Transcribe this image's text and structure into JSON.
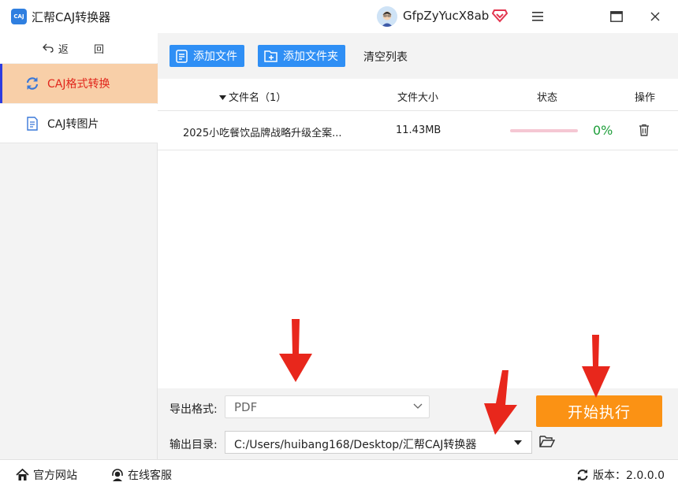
{
  "app": {
    "logo_text": "CAJ",
    "title": "汇帮CAJ转换器",
    "username": "GfpZyYucX8ab"
  },
  "sidebar": {
    "back_label": "返 回",
    "items": [
      {
        "label": "CAJ格式转换",
        "active": true
      },
      {
        "label": "CAJ转图片",
        "active": false
      }
    ]
  },
  "toolbar": {
    "add_file_label": "添加文件",
    "add_folder_label": "添加文件夹",
    "clear_label": "清空列表"
  },
  "table": {
    "columns": {
      "name": "文件名（1）",
      "size": "文件大小",
      "status": "状态",
      "action": "操作"
    },
    "rows": [
      {
        "name": "2025小吃餐饮品牌战略升级全案...",
        "size": "11.43MB",
        "progress": 0,
        "progress_label": "0%"
      }
    ]
  },
  "settings": {
    "format_label": "导出格式:",
    "format_value": "PDF",
    "dir_label": "输出目录:",
    "dir_value": "C:/Users/huibang168/Desktop/汇帮CAJ转换器",
    "start_label": "开始执行"
  },
  "footer": {
    "website_label": "官方网站",
    "support_label": "在线客服",
    "version_label": "版本：2.0.0.0"
  },
  "colors": {
    "primary": "#2f8ff5",
    "active_bg": "#f8cfa8",
    "active_text": "#e1261c",
    "start": "#fb9214",
    "progress_ok": "#1e9e3a",
    "arrow": "#e8271c"
  },
  "icons": [
    "caj-logo-icon",
    "avatar-icon",
    "vip-diamond-icon",
    "menu-icon",
    "maximize-icon",
    "close-icon",
    "back-icon",
    "refresh-icon",
    "document-icon",
    "add-file-icon",
    "add-folder-icon",
    "sort-down-icon",
    "trash-icon",
    "chevron-down-icon",
    "folder-open-icon",
    "home-icon",
    "headset-icon",
    "update-icon",
    "red-arrow-down-icon"
  ]
}
